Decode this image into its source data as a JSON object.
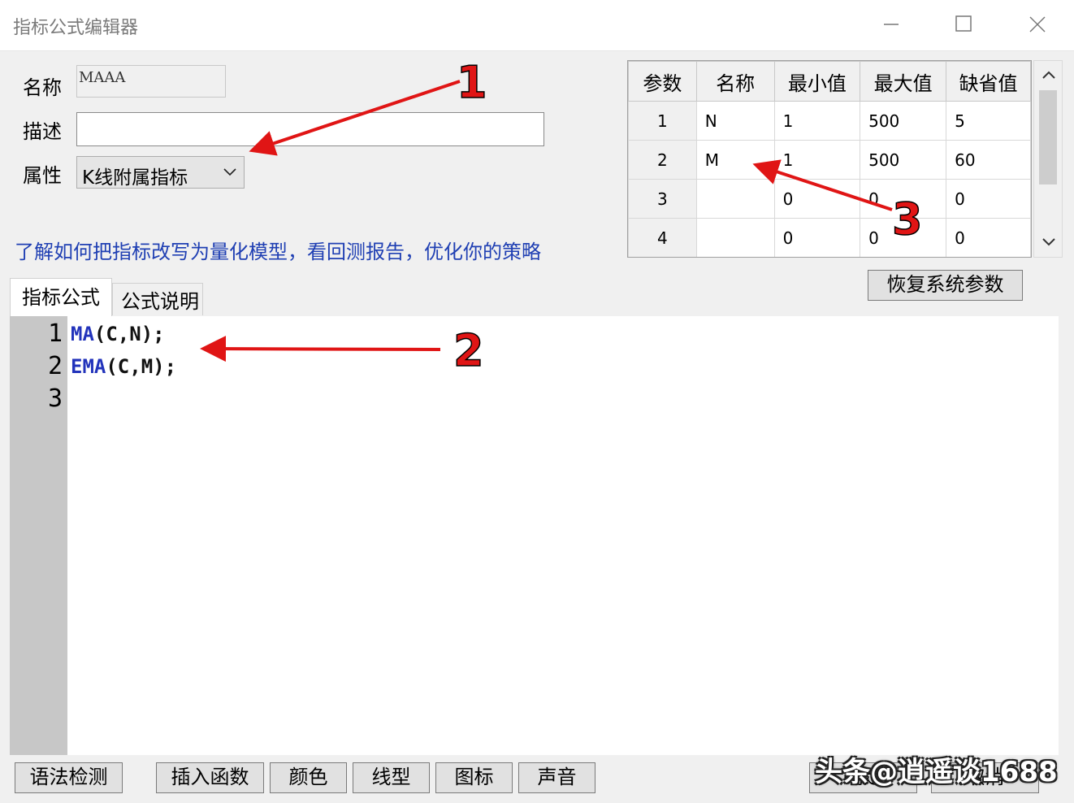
{
  "window": {
    "title": "指标公式编辑器"
  },
  "form": {
    "name_label": "名称",
    "name_value": "MAAA",
    "desc_label": "描述",
    "desc_value": "",
    "attr_label": "属性",
    "attr_value": "K线附属指标"
  },
  "link_text": "了解如何把指标改写为量化模型，看回测报告，优化你的策略",
  "params": {
    "headers": [
      "参数",
      "名称",
      "最小值",
      "最大值",
      "缺省值"
    ],
    "rows": [
      [
        "1",
        "N",
        "1",
        "500",
        "5"
      ],
      [
        "2",
        "M",
        "1",
        "500",
        "60"
      ],
      [
        "3",
        "",
        "0",
        "0",
        "0"
      ],
      [
        "4",
        "",
        "0",
        "0",
        "0"
      ]
    ],
    "restore_label": "恢复系统参数"
  },
  "tabs": [
    "指标公式",
    "公式说明"
  ],
  "editor": {
    "line_numbers": [
      "1",
      "2",
      "3"
    ],
    "lines": [
      {
        "fn": "MA",
        "rest": "(C,N);"
      },
      {
        "fn": "EMA",
        "rest": "(C,M);"
      },
      {
        "fn": "",
        "rest": ""
      }
    ]
  },
  "buttons": [
    "语法检测",
    "插入函数",
    "颜色",
    "线型",
    "图标",
    "声音",
    "确定",
    "取消"
  ],
  "annotations": [
    "1",
    "2",
    "3"
  ],
  "watermark": "头条@逍遥谈1688",
  "colors": {
    "arrow": "#e01515",
    "link": "#1f3fb3",
    "code_fn": "#2233bb"
  }
}
